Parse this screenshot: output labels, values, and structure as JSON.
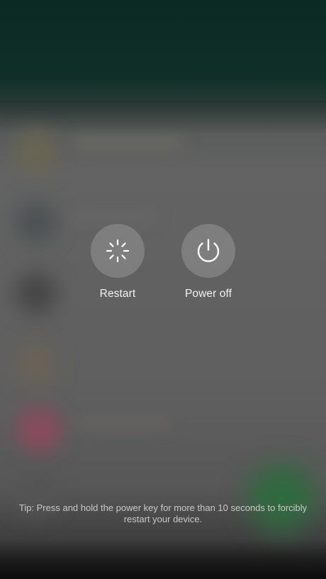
{
  "power_menu": {
    "options": [
      {
        "label": "Restart",
        "icon": "spinner-icon"
      },
      {
        "label": "Power off",
        "icon": "power-icon"
      }
    ],
    "tip": "Tip: Press and hold the power key for more than 10 seconds to forcibly restart your device."
  },
  "colors": {
    "button_background": "#969696",
    "label_text": "#f2f2f2",
    "tip_text": "#c9c9c9"
  }
}
